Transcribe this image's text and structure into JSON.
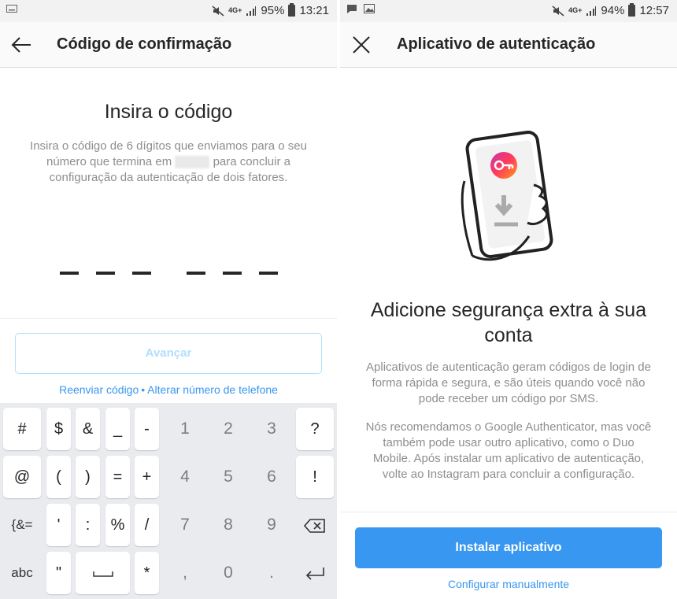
{
  "left": {
    "status": {
      "network": "4G+",
      "battery": "95%",
      "time": "13:21"
    },
    "header": {
      "title": "Código de confirmação",
      "back_icon": "arrow-left-icon"
    },
    "heading": "Insira o código",
    "description_before": "Insira o código de 6 dígitos que enviamos para o seu número que termina em",
    "description_after": "para concluir a configuração da autenticação de dois fatores.",
    "next_button": "Avançar",
    "resend_link": "Reenviar código",
    "link_separator": "•",
    "change_number_link": "Alterar número de telefone",
    "keyboard": {
      "row1": [
        "#",
        "$",
        "&",
        "_",
        "-",
        "1",
        "2",
        "3",
        "?"
      ],
      "row2": [
        "@",
        "(",
        ")",
        "=",
        "+",
        "4",
        "5",
        "6",
        "!"
      ],
      "row3": [
        "{&=",
        "'",
        ":",
        "%",
        "/",
        "7",
        "8",
        "9"
      ],
      "row4": [
        "abc",
        "\"",
        "*",
        ",",
        "0",
        "."
      ]
    }
  },
  "right": {
    "status": {
      "network": "4G+",
      "battery": "94%",
      "time": "12:57"
    },
    "header": {
      "title": "Aplicativo de autenticação",
      "close_icon": "close-icon"
    },
    "heading": "Adicione segurança extra à sua conta",
    "description1": "Aplicativos de autenticação geram códigos de login de forma rápida e segura, e são úteis quando você não pode receber um código por SMS.",
    "description2": "Nós recomendamos o Google Authenticator, mas você também pode usar outro aplicativo, como o Duo Mobile. Após instalar um aplicativo de autenticação, volte ao Instagram para concluir a configuração.",
    "install_button": "Instalar aplicativo",
    "manual_link": "Configurar manualmente"
  },
  "colors": {
    "accent": "#3897f0",
    "accent_disabled": "#b2dffc",
    "muted_text": "#8e8e8e"
  }
}
